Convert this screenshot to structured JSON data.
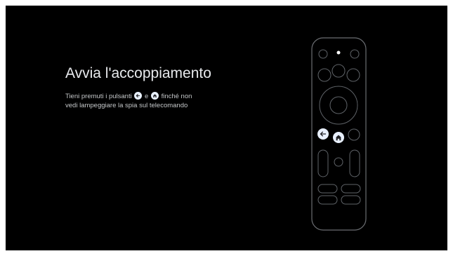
{
  "pairing": {
    "title": "Avvia l'accoppiamento",
    "instruction_part1": "Tieni premuti i pulsanti",
    "instruction_conj": "e",
    "instruction_part2": "finché non",
    "instruction_line2": "vedi lampeggiare la spia sul telecomando",
    "highlight_icons": [
      "back-icon",
      "home-icon"
    ]
  },
  "colors": {
    "background": "#000000",
    "remote_outline": "#5f6368",
    "highlight": "#e8f0fe",
    "icon_dark": "#1a73e8"
  }
}
